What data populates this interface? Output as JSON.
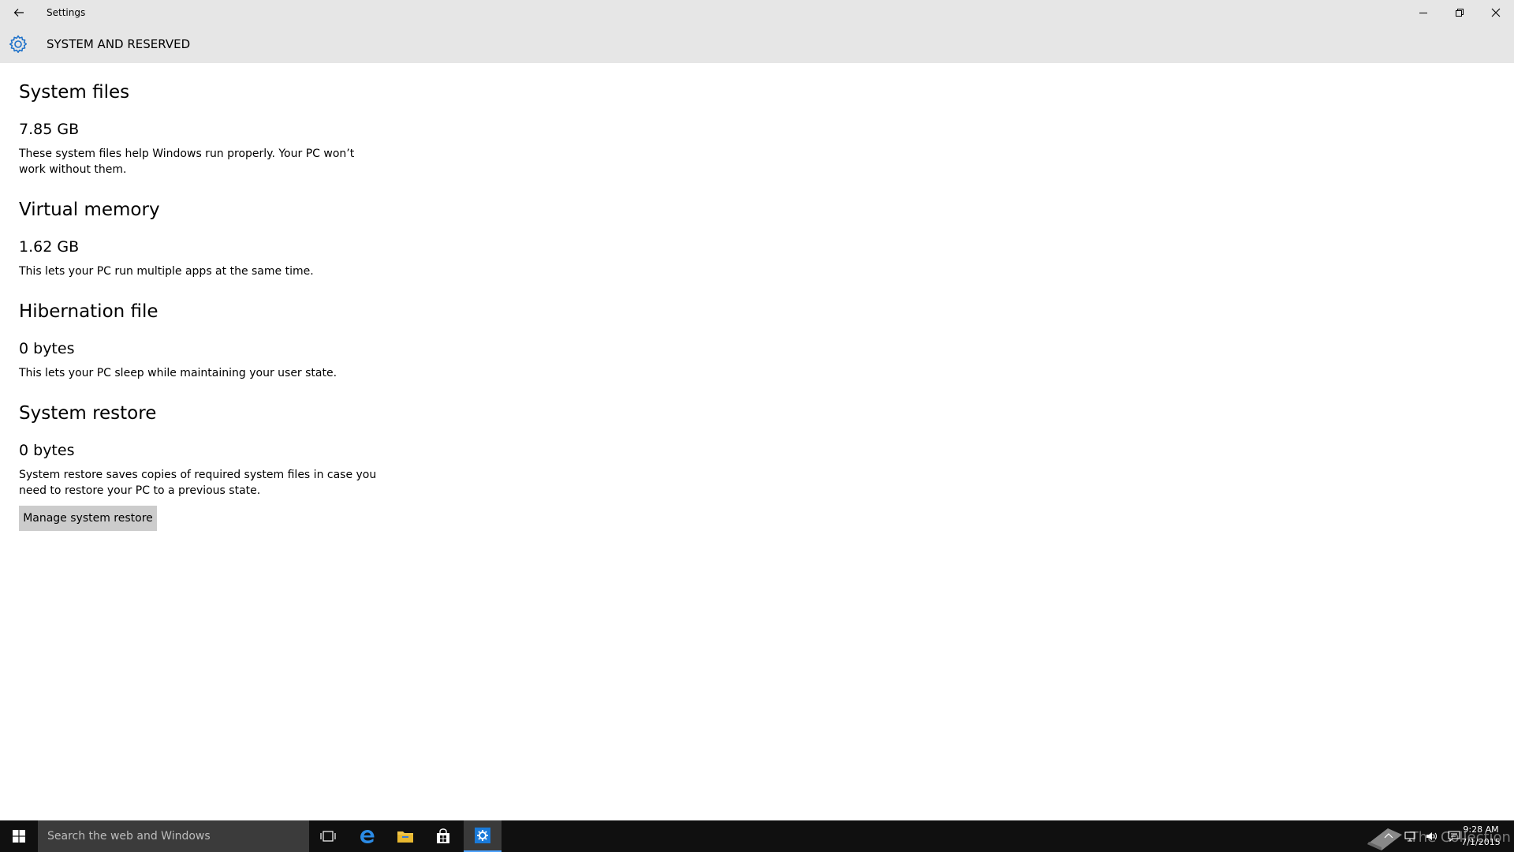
{
  "window": {
    "title": "Settings",
    "header_title": "SYSTEM AND RESERVED"
  },
  "sections": [
    {
      "title": "System files",
      "size": "7.85 GB",
      "description": "These system files help Windows run properly. Your PC won’t work without them."
    },
    {
      "title": "Virtual memory",
      "size": "1.62 GB",
      "description": "This lets your PC run multiple apps at the same time."
    },
    {
      "title": "Hibernation file",
      "size": "0 bytes",
      "description": "This lets your PC sleep while maintaining your user state."
    },
    {
      "title": "System restore",
      "size": "0 bytes",
      "description": "System restore saves copies of required system files in case you need to restore your PC to a previous state."
    }
  ],
  "actions": {
    "manage_system_restore": "Manage system restore"
  },
  "taskbar": {
    "search_placeholder": "Search the web and Windows",
    "time": "9:28 AM",
    "date": "7/1/2015"
  },
  "watermark": "The Collection Book",
  "colors": {
    "titlebar_bg": "#e6e6e6",
    "accent": "#0078d7",
    "taskbar_bg": "#101010"
  },
  "icons": [
    "back-arrow-icon",
    "gear-icon",
    "minimize-icon",
    "restore-icon",
    "close-icon",
    "windows-logo-icon",
    "task-view-icon",
    "edge-icon",
    "file-explorer-icon",
    "store-icon",
    "settings-icon",
    "chevron-up-icon",
    "network-icon",
    "volume-icon",
    "action-center-icon"
  ]
}
